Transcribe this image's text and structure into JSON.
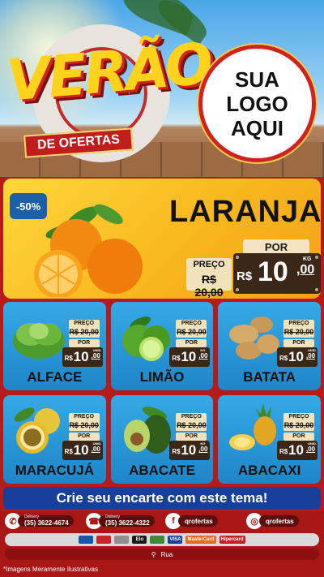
{
  "hero": {
    "title": "VERÃO",
    "subtitle": "DE OFERTAS",
    "logo_lines": [
      "SUA",
      "LOGO",
      "AQUI"
    ]
  },
  "featured": {
    "discount": "-50%",
    "name": "LARANJA",
    "old_label": "PREÇO",
    "old_price": "R$ 20,00",
    "new_label": "POR",
    "currency": "R$",
    "price_int": "10",
    "price_cents": ",00",
    "unit": "KG",
    "art_icon": "orange-icon"
  },
  "products": [
    {
      "name": "ALFACE",
      "old_label": "PREÇO",
      "old_price": "R$ 20,00",
      "new_label": "POR",
      "currency": "R$",
      "price_int": "10",
      "price_cents": ",00",
      "unit": "UNID.",
      "art_icon": "lettuce-icon"
    },
    {
      "name": "LIMÃO",
      "old_label": "PREÇO",
      "old_price": "R$ 20,00",
      "new_label": "POR",
      "currency": "R$",
      "price_int": "10",
      "price_cents": ",00",
      "unit": "KG",
      "art_icon": "lime-icon"
    },
    {
      "name": "BATATA",
      "old_label": "PREÇO",
      "old_price": "R$ 20,00",
      "new_label": "POR",
      "currency": "R$",
      "price_int": "10",
      "price_cents": ",00",
      "unit": "UNID.",
      "art_icon": "potato-icon"
    },
    {
      "name": "MARACUJÁ",
      "old_label": "PREÇO",
      "old_price": "R$ 20,00",
      "new_label": "POR",
      "currency": "R$",
      "price_int": "10",
      "price_cents": ",00",
      "unit": "UNID.",
      "art_icon": "passionfruit-icon"
    },
    {
      "name": "ABACATE",
      "old_label": "PREÇO",
      "old_price": "R$ 20,00",
      "new_label": "POR",
      "currency": "R$",
      "price_int": "10",
      "price_cents": ",00",
      "unit": "KG",
      "art_icon": "avocado-icon"
    },
    {
      "name": "ABACAXI",
      "old_label": "PREÇO",
      "old_price": "R$ 20,00",
      "new_label": "POR",
      "currency": "R$",
      "price_int": "10",
      "price_cents": ",00",
      "unit": "UNID.",
      "art_icon": "pineapple-icon"
    }
  ],
  "cta": "Crie seu encarte com este tema!",
  "footer": {
    "contacts": [
      {
        "icon": "whatsapp-icon",
        "label": "Delivery",
        "value": "(35) 3622-4674"
      },
      {
        "icon": "phone-icon",
        "label": "Delivery",
        "value": "(35) 3622-4322"
      },
      {
        "icon": "facebook-icon",
        "label": "",
        "value": "qrofertas"
      },
      {
        "icon": "instagram-icon",
        "label": "",
        "value": "qrofertas"
      }
    ],
    "payments": [
      "VISA",
      "MasterCard",
      "Hipercard",
      "Elo"
    ],
    "address": "Rua",
    "disclaimer": "*Imagens Meramente Ilustrativas"
  },
  "colors": {
    "accent_red": "#b61a1a",
    "featured_yellow": "#ffd73a",
    "card_blue": "#1e86c8",
    "cta_blue": "#183f9a",
    "price_board": "#3b2718"
  }
}
